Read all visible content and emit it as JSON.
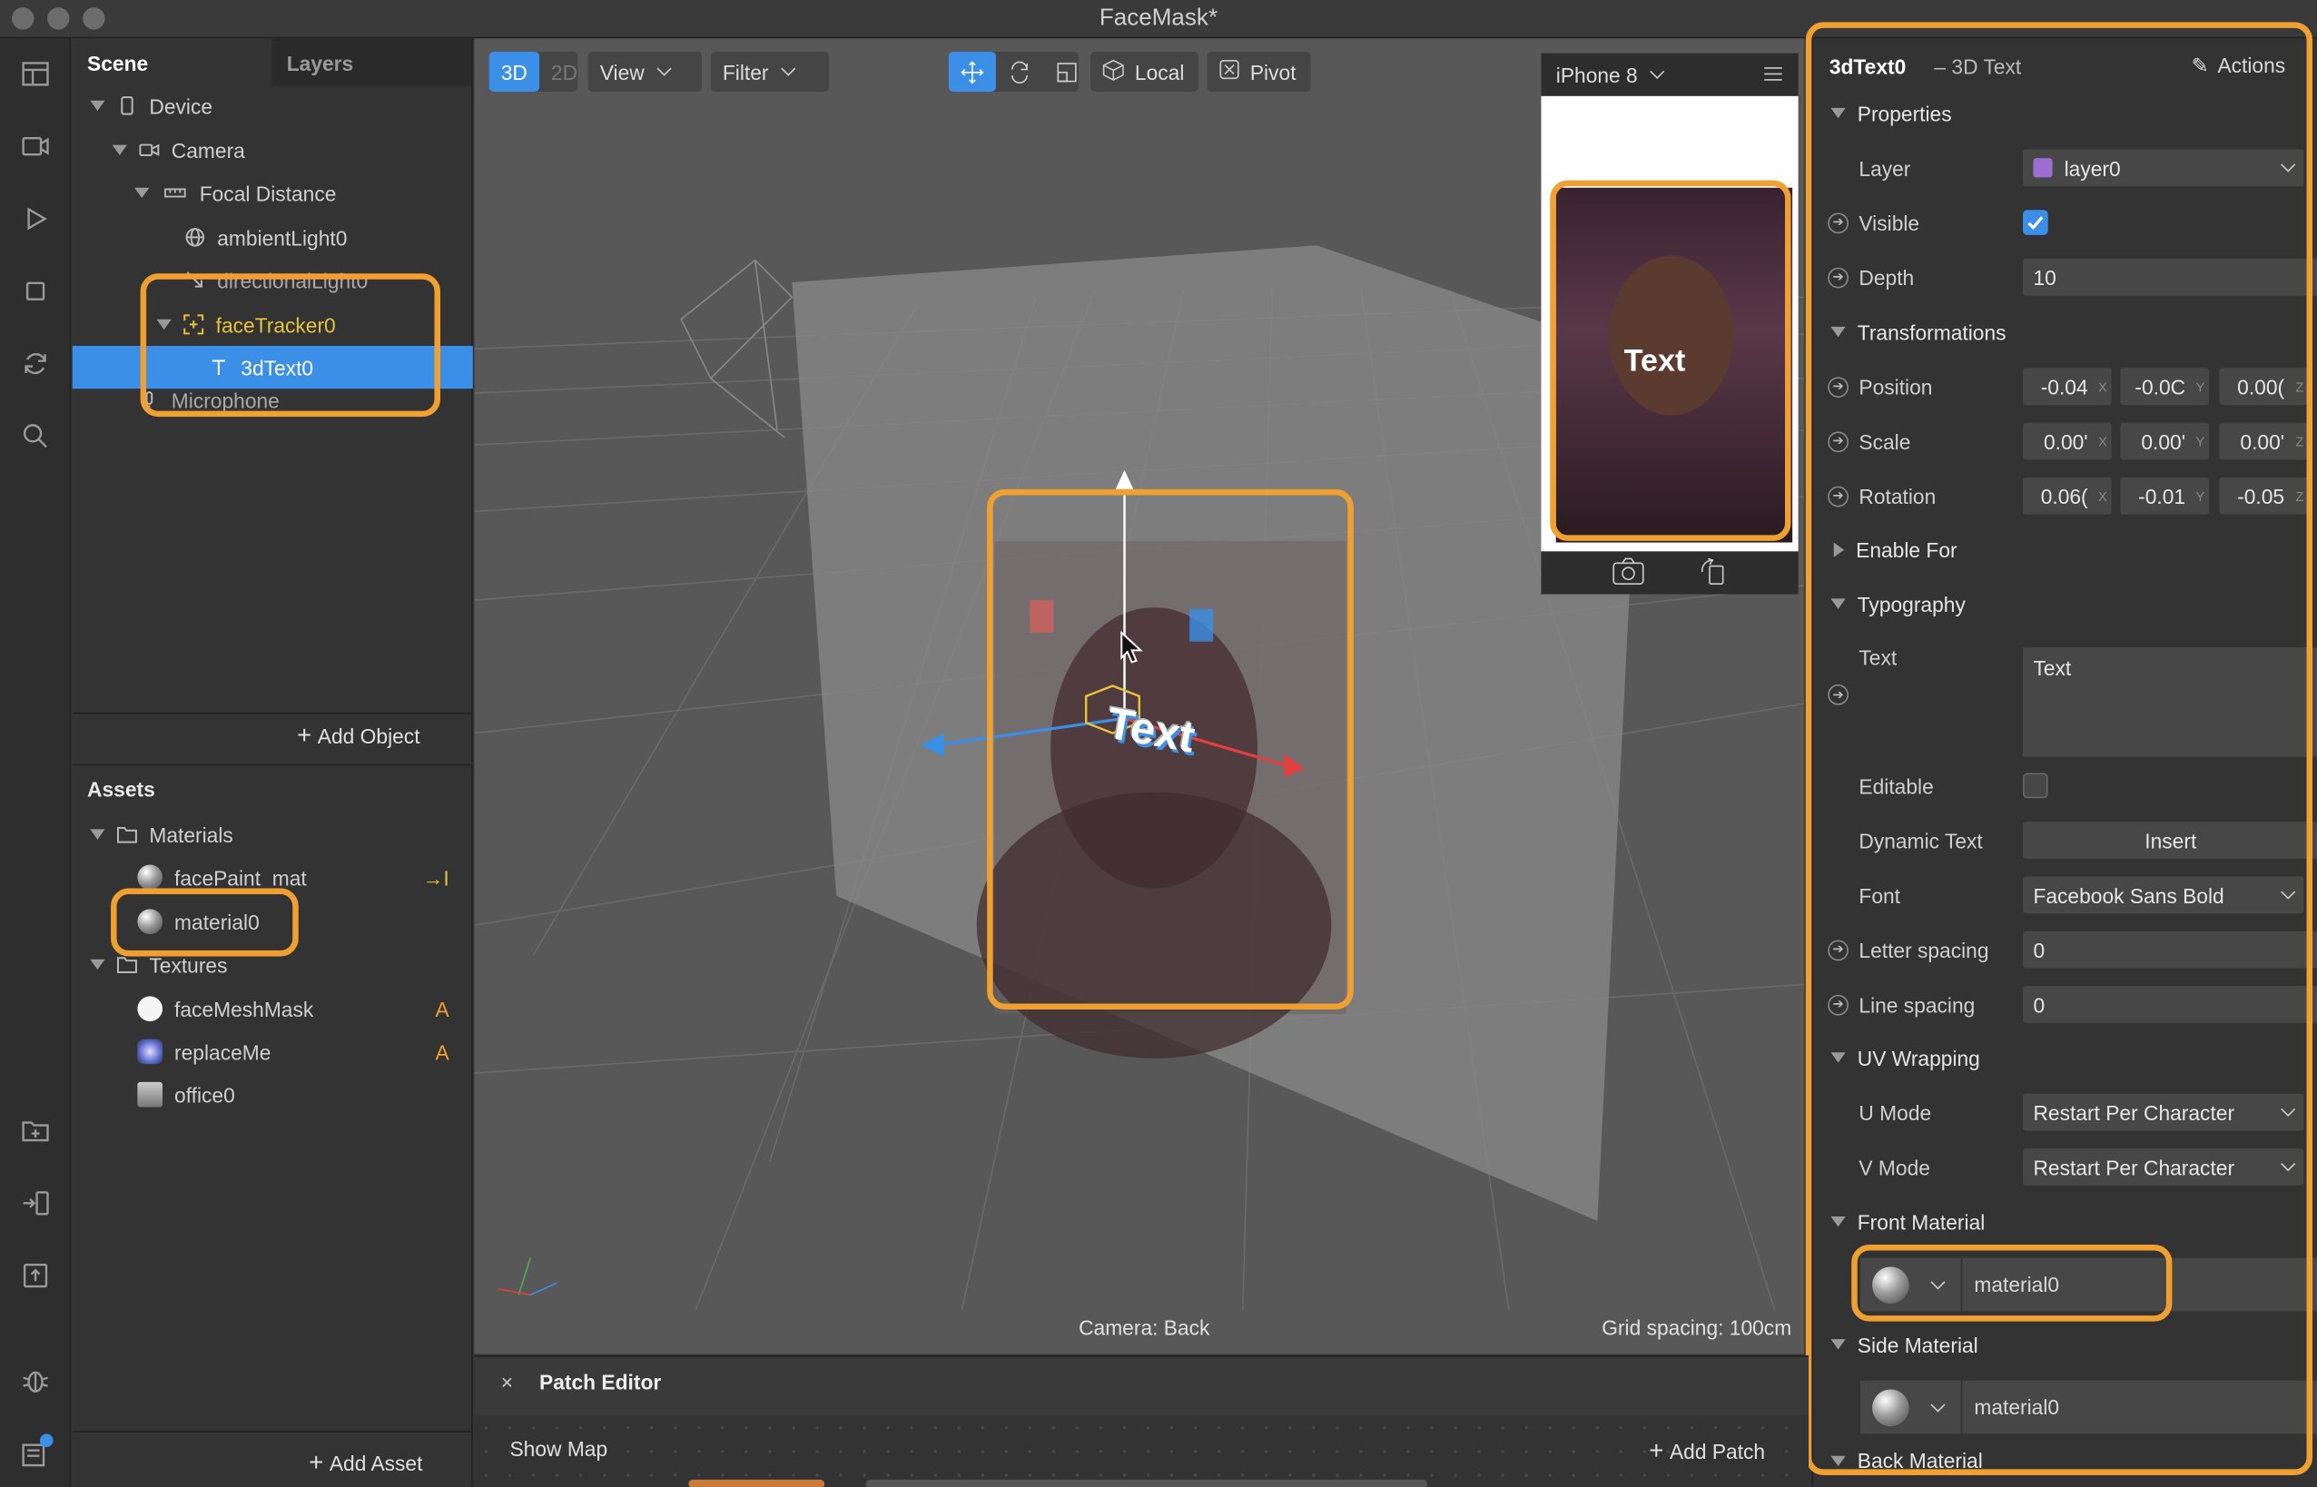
{
  "app": {
    "title": "FaceMask*"
  },
  "scene": {
    "tabs": [
      "Scene",
      "Layers"
    ],
    "tree": [
      {
        "label": "Device"
      },
      {
        "label": "Camera"
      },
      {
        "label": "Focal Distance"
      },
      {
        "label": "ambientLight0"
      },
      {
        "label": "directionalLight0"
      },
      {
        "label": "faceTracker0"
      },
      {
        "label": "3dText0"
      },
      {
        "label": "Microphone"
      }
    ],
    "add_object": "Add Object"
  },
  "assets": {
    "title": "Assets",
    "items": [
      {
        "label": "Materials"
      },
      {
        "label": "facePaint_mat",
        "badge": "→I"
      },
      {
        "label": "material0"
      },
      {
        "label": "Textures"
      },
      {
        "label": "faceMeshMask",
        "badge": "A"
      },
      {
        "label": "replaceMe",
        "badge": "A"
      },
      {
        "label": "office0"
      }
    ],
    "add_asset": "Add Asset"
  },
  "viewport": {
    "mode_3d": "3D",
    "mode_2d": "2D",
    "view": "View",
    "filter": "Filter",
    "local": "Local",
    "pivot": "Pivot",
    "text_label": "Text",
    "camera": "Camera: Back",
    "grid": "Grid spacing: 100cm"
  },
  "phone": {
    "device": "iPhone 8",
    "overlay_text": "Text"
  },
  "inspector": {
    "object": "3dText0",
    "type": "– 3D Text",
    "actions": "Actions",
    "properties": "Properties",
    "layer_label": "Layer",
    "layer_value": "layer0",
    "visible_label": "Visible",
    "depth_label": "Depth",
    "depth_value": "10",
    "transformations": "Transformations",
    "position_label": "Position",
    "position": [
      "-0.04",
      "-0.0C",
      "0.00("
    ],
    "scale_label": "Scale",
    "scale": [
      "0.00'",
      "0.00'",
      "0.00'"
    ],
    "rotation_label": "Rotation",
    "rotation": [
      "0.06(",
      "-0.01",
      "-0.05"
    ],
    "enable_for": "Enable For",
    "typography": "Typography",
    "text_label": "Text",
    "text_value": "Text",
    "editable_label": "Editable",
    "dynamic_label": "Dynamic Text",
    "insert": "Insert",
    "font_label": "Font",
    "font_value": "Facebook Sans Bold",
    "letter_label": "Letter spacing",
    "letter_value": "0",
    "line_label": "Line spacing",
    "line_value": "0",
    "uv": "UV Wrapping",
    "umode_label": "U Mode",
    "umode_value": "Restart Per Character",
    "vmode_label": "V Mode",
    "vmode_value": "Restart Per Character",
    "front": "Front Material",
    "front_value": "material0",
    "side": "Side Material",
    "side_value": "material0",
    "back": "Back Material"
  },
  "patch": {
    "title": "Patch Editor",
    "show_map": "Show Map",
    "add_patch": "Add Patch"
  },
  "colors": {
    "accent": "#3b8fe6",
    "highlight": "#f0a030",
    "tracker": "#e8c23a"
  }
}
